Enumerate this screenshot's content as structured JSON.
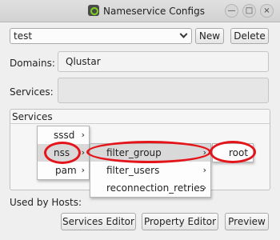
{
  "window": {
    "title": "Nameservice Configs",
    "controls": {
      "minimize": "—",
      "maximize": "□",
      "close": "×"
    }
  },
  "toolbar": {
    "config_selected": "test",
    "new_label": "New",
    "delete_label": "Delete"
  },
  "domains": {
    "label": "Domains:",
    "value": "Qlustar"
  },
  "services_field": {
    "label": "Services:",
    "value": ""
  },
  "services_group": {
    "title": "Services"
  },
  "menu_level1": [
    {
      "label": "sssd",
      "has_submenu": true
    },
    {
      "label": "nss",
      "has_submenu": true,
      "selected": true
    },
    {
      "label": "pam",
      "has_submenu": true
    }
  ],
  "menu_level2": [
    {
      "label": "filter_group",
      "has_submenu": true,
      "selected": true
    },
    {
      "label": "filter_users",
      "has_submenu": true
    },
    {
      "label": "reconnection_retries",
      "has_submenu": true
    }
  ],
  "menu_level3": [
    {
      "label": "root"
    }
  ],
  "arrow_glyph": "›",
  "used_by_hosts": {
    "label": "Used by Hosts:"
  },
  "bottom_buttons": {
    "services_editor": "Services Editor",
    "property_editor": "Property Editor",
    "preview": "Preview"
  },
  "highlight_color": "#e3151b"
}
